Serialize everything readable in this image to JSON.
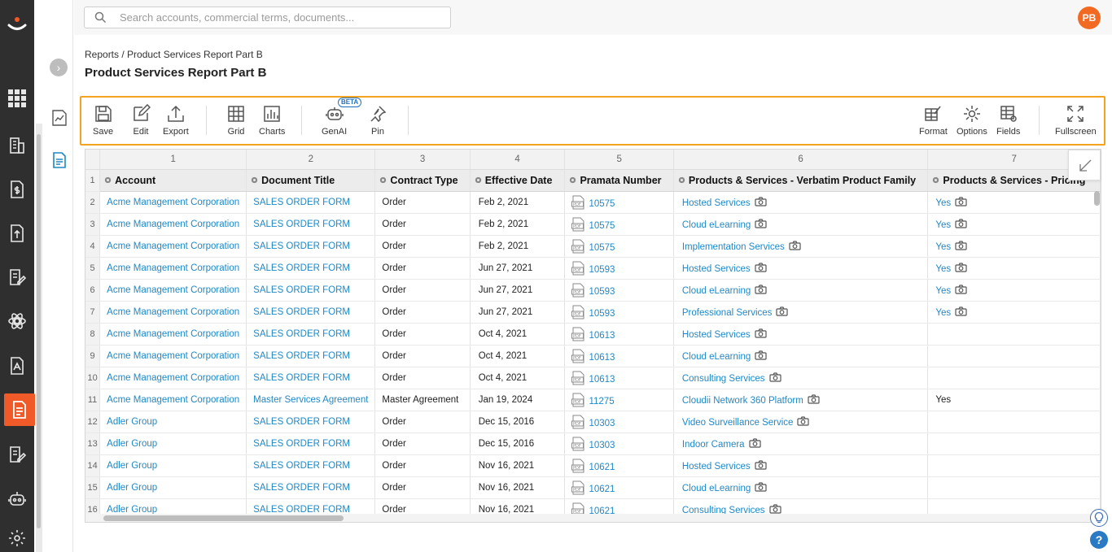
{
  "app": {
    "brand_color": "#f05a28",
    "accent_color": "#1e88c7",
    "toolbar_highlight": "#f4a321"
  },
  "search": {
    "placeholder": "Search accounts, commercial terms, documents..."
  },
  "user": {
    "initials": "PB"
  },
  "breadcrumb": "Reports / Product Services Report Part B",
  "page_title": "Product Services Report Part B",
  "rail_icons": [
    "apps-grid-icon",
    "building-icon",
    "contract-dollar-icon",
    "upload-document-icon",
    "edit-document-icon",
    "settings-atom-icon",
    "pdf-document-icon",
    "reports-icon",
    "signature-icon",
    "robot-icon",
    "gear-icon"
  ],
  "toolbar": {
    "save": "Save",
    "edit": "Edit",
    "export": "Export",
    "grid": "Grid",
    "charts": "Charts",
    "genai": "GenAI",
    "beta": "BETA",
    "pin": "Pin",
    "format": "Format",
    "options": "Options",
    "fields": "Fields",
    "fullscreen": "Fullscreen"
  },
  "table": {
    "col_numbers": [
      "1",
      "2",
      "3",
      "4",
      "5",
      "6",
      "7"
    ],
    "headers": [
      "Account",
      "Document Title",
      "Contract Type",
      "Effective Date",
      "Pramata Number",
      "Products & Services - Verbatim Product Family",
      "Products & Services - Pricing"
    ],
    "header_row_num": "1",
    "rows": [
      {
        "n": "2",
        "account": "Acme Management Corporation",
        "title": "SALES ORDER FORM",
        "type": "Order",
        "date": "Feb 2, 2021",
        "num": "10575",
        "product": "Hosted Services",
        "pricing": "Yes",
        "pricing_link": true
      },
      {
        "n": "3",
        "account": "Acme Management Corporation",
        "title": "SALES ORDER FORM",
        "type": "Order",
        "date": "Feb 2, 2021",
        "num": "10575",
        "product": "Cloud eLearning",
        "pricing": "Yes",
        "pricing_link": true
      },
      {
        "n": "4",
        "account": "Acme Management Corporation",
        "title": "SALES ORDER FORM",
        "type": "Order",
        "date": "Feb 2, 2021",
        "num": "10575",
        "product": "Implementation Services",
        "pricing": "Yes",
        "pricing_link": true
      },
      {
        "n": "5",
        "account": "Acme Management Corporation",
        "title": "SALES ORDER FORM",
        "type": "Order",
        "date": "Jun 27, 2021",
        "num": "10593",
        "product": "Hosted Services",
        "pricing": "Yes",
        "pricing_link": true
      },
      {
        "n": "6",
        "account": "Acme Management Corporation",
        "title": "SALES ORDER FORM",
        "type": "Order",
        "date": "Jun 27, 2021",
        "num": "10593",
        "product": "Cloud eLearning",
        "pricing": "Yes",
        "pricing_link": true
      },
      {
        "n": "7",
        "account": "Acme Management Corporation",
        "title": "SALES ORDER FORM",
        "type": "Order",
        "date": "Jun 27, 2021",
        "num": "10593",
        "product": "Professional Services",
        "pricing": "Yes",
        "pricing_link": true
      },
      {
        "n": "8",
        "account": "Acme Management Corporation",
        "title": "SALES ORDER FORM",
        "type": "Order",
        "date": "Oct 4, 2021",
        "num": "10613",
        "product": "Hosted Services",
        "pricing": "",
        "pricing_link": false
      },
      {
        "n": "9",
        "account": "Acme Management Corporation",
        "title": "SALES ORDER FORM",
        "type": "Order",
        "date": "Oct 4, 2021",
        "num": "10613",
        "product": "Cloud eLearning",
        "pricing": "",
        "pricing_link": false
      },
      {
        "n": "10",
        "account": "Acme Management Corporation",
        "title": "SALES ORDER FORM",
        "type": "Order",
        "date": "Oct 4, 2021",
        "num": "10613",
        "product": "Consulting Services",
        "pricing": "",
        "pricing_link": false
      },
      {
        "n": "11",
        "account": "Acme Management Corporation",
        "title": "Master Services Agreement",
        "type": "Master Agreement",
        "date": "Jan 19, 2024",
        "num": "11275",
        "product": "Cloudii Network 360 Platform",
        "pricing": "Yes",
        "pricing_link": false
      },
      {
        "n": "12",
        "account": "Adler Group",
        "title": "SALES ORDER FORM",
        "type": "Order",
        "date": "Dec 15, 2016",
        "num": "10303",
        "product": "Video Surveillance Service",
        "pricing": "",
        "pricing_link": false
      },
      {
        "n": "13",
        "account": "Adler Group",
        "title": "SALES ORDER FORM",
        "type": "Order",
        "date": "Dec 15, 2016",
        "num": "10303",
        "product": "Indoor Camera",
        "pricing": "",
        "pricing_link": false
      },
      {
        "n": "14",
        "account": "Adler Group",
        "title": "SALES ORDER FORM",
        "type": "Order",
        "date": "Nov 16, 2021",
        "num": "10621",
        "product": "Hosted Services",
        "pricing": "",
        "pricing_link": false
      },
      {
        "n": "15",
        "account": "Adler Group",
        "title": "SALES ORDER FORM",
        "type": "Order",
        "date": "Nov 16, 2021",
        "num": "10621",
        "product": "Cloud eLearning",
        "pricing": "",
        "pricing_link": false
      },
      {
        "n": "16",
        "account": "Adler Group",
        "title": "SALES ORDER FORM",
        "type": "Order",
        "date": "Nov 16, 2021",
        "num": "10621",
        "product": "Consulting Services",
        "pricing": "",
        "pricing_link": false
      }
    ]
  },
  "help": {
    "label": "?"
  }
}
